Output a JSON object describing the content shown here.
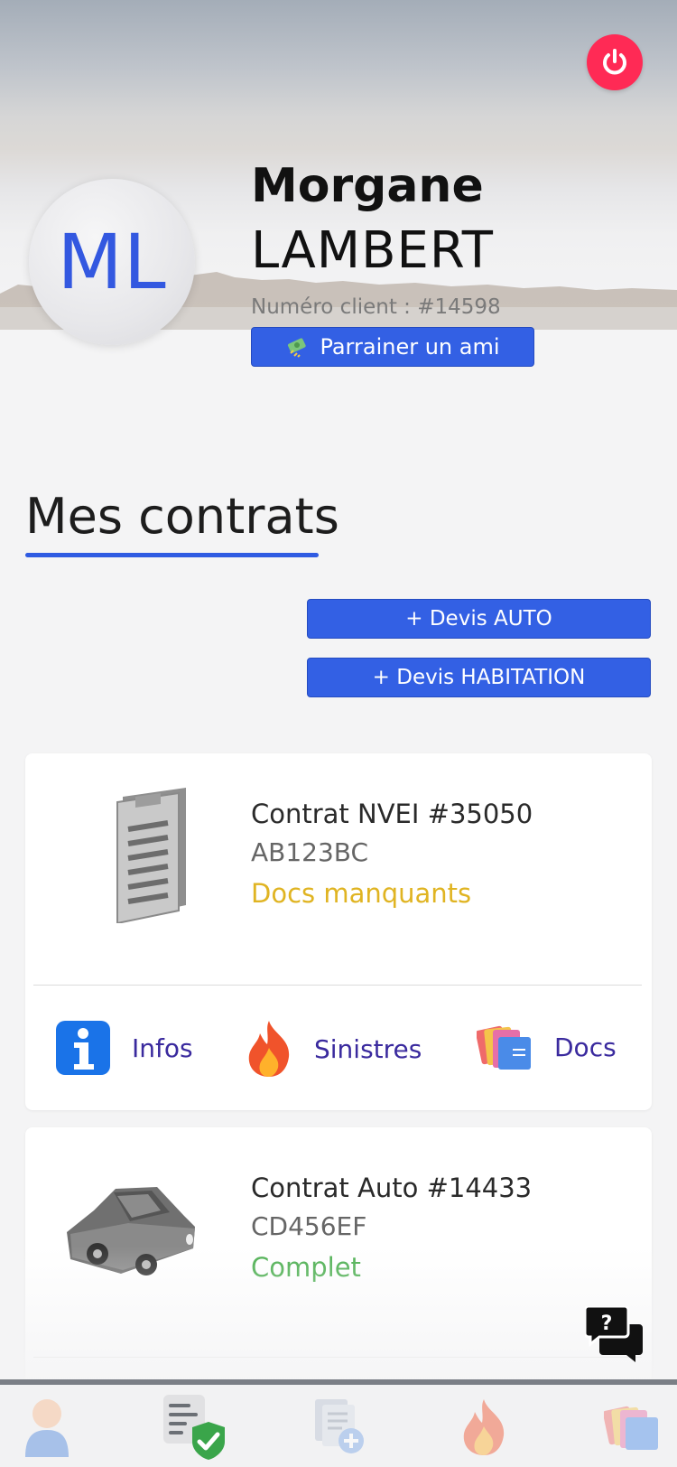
{
  "profile": {
    "initials": "ML",
    "first_name": "Morgane",
    "last_name": "LAMBERT",
    "client_number": "Numéro client : #14598",
    "referral_label": "Parrainer un ami"
  },
  "section": {
    "title": "Mes contrats"
  },
  "quote_buttons": {
    "auto": "+ Devis AUTO",
    "home": "+ Devis HABITATION"
  },
  "contracts": [
    {
      "title": "Contrat NVEI #35050",
      "plate": "AB123BC",
      "status": "Docs manquants",
      "status_color": "#e0b422",
      "icon": "clipboard-icon"
    },
    {
      "title": "Contrat Auto #14433",
      "plate": "CD456EF",
      "status": "Complet",
      "status_color": "#4caf50",
      "icon": "car-icon"
    }
  ],
  "contract_actions": {
    "infos": "Infos",
    "claims": "Sinistres",
    "docs": "Docs"
  },
  "colors": {
    "accent": "#3360e4",
    "power": "#ff2a55",
    "action_text": "#3a2a9e"
  },
  "tabbar": [
    "profile-icon",
    "contracts-icon",
    "new-document-icon",
    "claims-fire-icon",
    "folders-icon"
  ]
}
